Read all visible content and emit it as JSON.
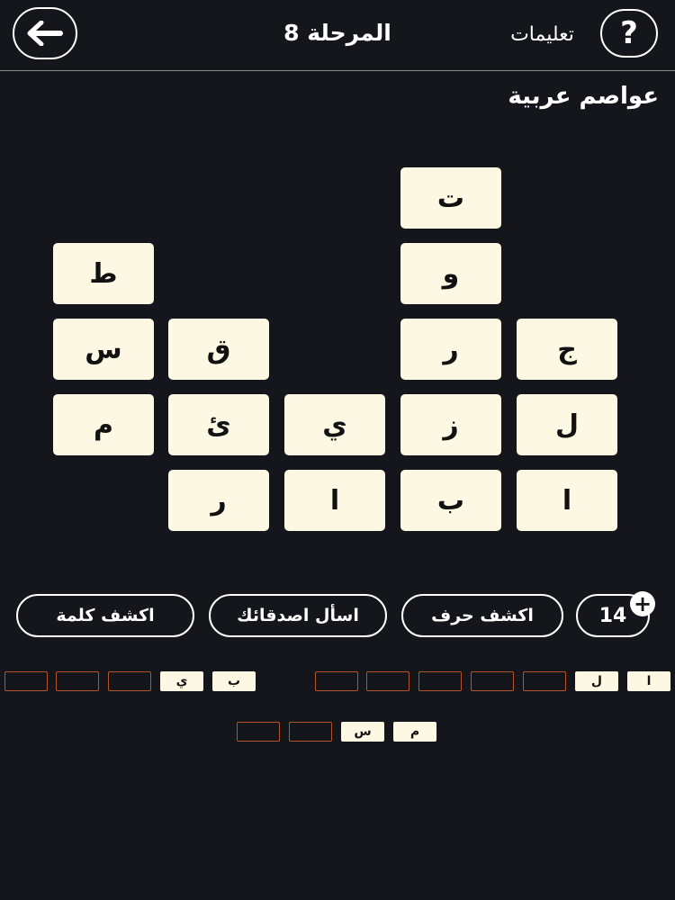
{
  "header": {
    "level_title": "المرحلة 8",
    "instructions_label": "تعليمات",
    "help_glyph": "?",
    "back_icon": "arrow-left-icon"
  },
  "category": "عواصم عربية",
  "grid": {
    "columns": [
      {
        "letters": [
          "ا",
          "ل",
          "ج"
        ]
      },
      {
        "letters": [
          "ب",
          "ز",
          "ر",
          "و",
          "ت"
        ]
      },
      {
        "letters": [
          "ا",
          "ي"
        ]
      },
      {
        "letters": [
          "ر",
          "ئ",
          "ق"
        ]
      },
      {
        "letters": [
          "م",
          "س",
          "ط"
        ]
      }
    ]
  },
  "actions": {
    "coins": "14",
    "reveal_letter": "اكشف حرف",
    "ask_friends": "اسأل اصدقائك",
    "reveal_word": "اكشف كلمة"
  },
  "answers": {
    "row1_right": [
      "ا",
      "ل",
      "",
      "",
      "",
      "",
      ""
    ],
    "row1_left": [
      "ب",
      "ي",
      "",
      "",
      ""
    ],
    "row2": [
      "م",
      "س",
      "",
      ""
    ]
  },
  "colors": {
    "background": "#15161c",
    "tile": "#fdf8e3",
    "slot_border": "#b5542a"
  }
}
